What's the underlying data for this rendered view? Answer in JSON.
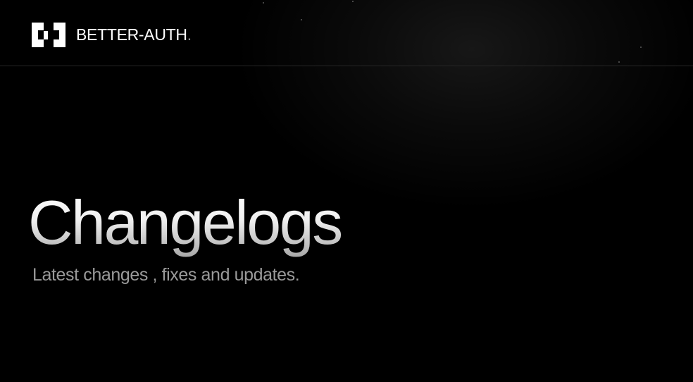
{
  "header": {
    "brand_name": "BETTER-AUTH",
    "brand_suffix": ".",
    "logo_icon": "better-auth-logo-icon"
  },
  "hero": {
    "title": "Changelogs",
    "subtitle": "Latest changes , fixes and updates."
  },
  "colors": {
    "background": "#000000",
    "title_gradient_top": "#ffffff",
    "title_gradient_bottom": "#a8a8a8",
    "subtitle": "#9a9a9a",
    "divider": "#262626"
  }
}
